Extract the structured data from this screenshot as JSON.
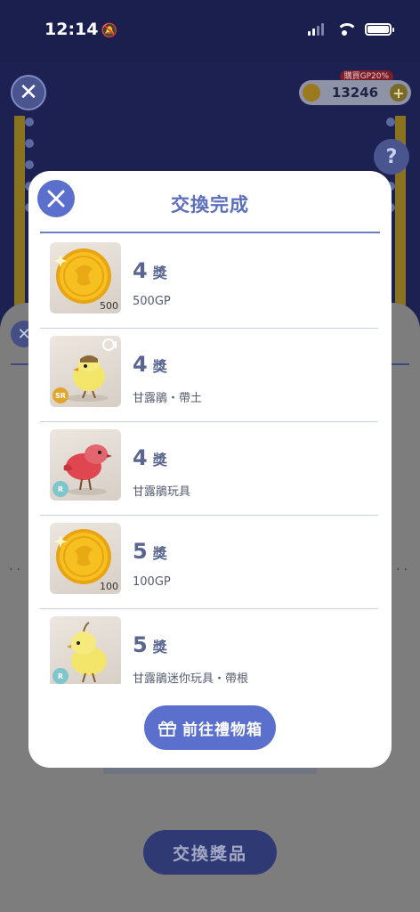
{
  "status_bar": {
    "time": "12:14"
  },
  "background": {
    "coin_balance": "13246",
    "promo_tag": "購買GP20%",
    "exchange_button_label": "交換獎品"
  },
  "modal": {
    "title": "交換完成",
    "button_label": "前往禮物箱",
    "items": [
      {
        "count": "4",
        "unit": "獎",
        "name": "500GP",
        "thumb": "gold-coin",
        "qty_badge": "500"
      },
      {
        "count": "4",
        "unit": "獎",
        "name": "甘露鵑・帶土",
        "thumb": "yellow-bird",
        "rarity": "SR"
      },
      {
        "count": "4",
        "unit": "獎",
        "name": "甘露鵑玩具",
        "thumb": "red-bird",
        "rarity": "R"
      },
      {
        "count": "5",
        "unit": "獎",
        "name": "100GP",
        "thumb": "gold-coin",
        "qty_badge": "100"
      },
      {
        "count": "5",
        "unit": "獎",
        "name": "甘露鵑迷你玩具・帶根",
        "thumb": "pale-yellow-bird",
        "rarity": "R"
      }
    ]
  },
  "colors": {
    "accent": "#5b70cc",
    "title": "#5b6fbd",
    "count": "#5a6690"
  }
}
